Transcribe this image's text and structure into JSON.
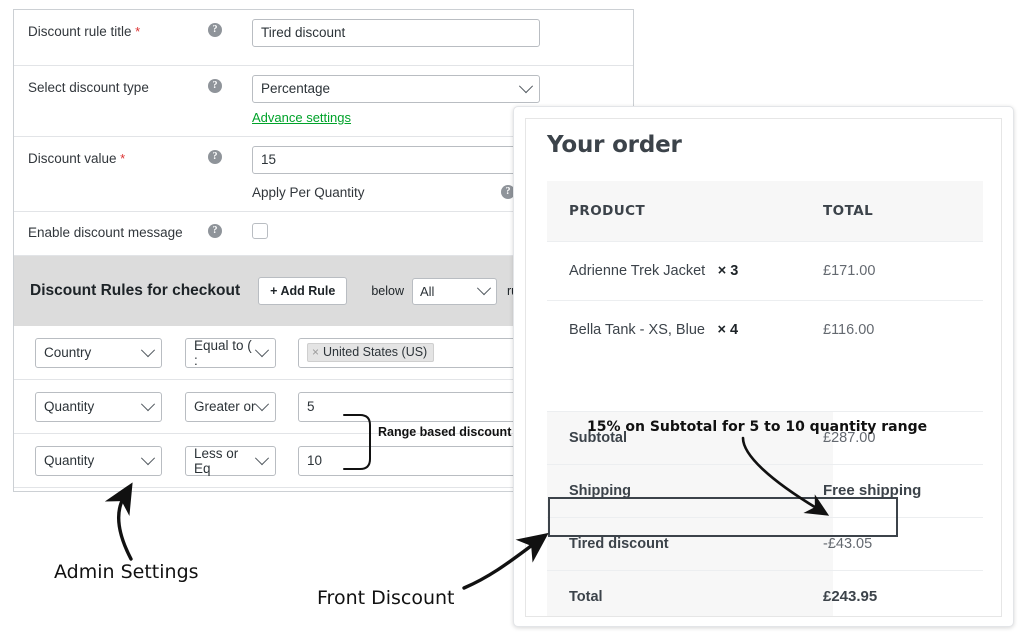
{
  "admin": {
    "rows": [
      {
        "label": "Discount rule title",
        "required": true,
        "help": "?",
        "field_type": "text",
        "value": "Tired discount"
      },
      {
        "label": "Select discount type",
        "required": false,
        "help": "?",
        "field_type": "select",
        "value": "Percentage",
        "sub_link": "Advance settings"
      },
      {
        "label": "Discount value",
        "required": true,
        "help": "?",
        "field_type": "text",
        "value": "15",
        "sub_label": "Apply Per Quantity",
        "sub_help": "?",
        "sub_checkbox_checked": false
      },
      {
        "label": "Enable discount message",
        "required": false,
        "help": "?",
        "field_type": "checkbox",
        "checkbox_checked": false
      }
    ],
    "rules_header": {
      "title": "Discount Rules for checkout",
      "add_rule_label": "+ Add Rule",
      "below_label": "below",
      "match_select_value": "All",
      "after_label": "rule ma"
    },
    "rules": [
      {
        "field": "Country",
        "operator": "Equal to ( :",
        "value_tag": "United States (US)",
        "tag_close": "×",
        "value_text": ""
      },
      {
        "field": "Quantity",
        "operator": "Greater or",
        "value_tag": "",
        "value_text": "5"
      },
      {
        "field": "Quantity",
        "operator": "Less or Eq",
        "value_tag": "",
        "value_text": "10"
      }
    ]
  },
  "order": {
    "title": "Your order",
    "columns": {
      "product": "PRODUCT",
      "total": "TOTAL"
    },
    "line_items": [
      {
        "name": "Adrienne Trek Jacket",
        "qty_sep": "×",
        "qty": "3",
        "total": "£171.00"
      },
      {
        "name": "Bella Tank - XS, Blue",
        "qty_sep": "×",
        "qty": "4",
        "total": "£116.00"
      }
    ],
    "summary": [
      {
        "label": "Subtotal",
        "value": "£287.00",
        "bold_value": false
      },
      {
        "label": "Shipping",
        "value": "Free shipping",
        "bold_value": true
      },
      {
        "label": "Tired discount",
        "value": "-£43.05",
        "bold_value": false
      },
      {
        "label": "Total",
        "value": "£243.95",
        "bold_value": true
      }
    ]
  },
  "annotations": {
    "admin_settings": "Admin Settings",
    "front_discount": "Front Discount",
    "range_based": "Range based discount",
    "percent_note": "15% on Subtotal for 5 to 10 quantity range"
  },
  "colors": {
    "accent_green": "#00a32a",
    "required_red": "#dc3232",
    "panel_border": "#ccd0d4",
    "header_band": "#dcdcdc",
    "table_head_bg": "#f7f7f7"
  }
}
